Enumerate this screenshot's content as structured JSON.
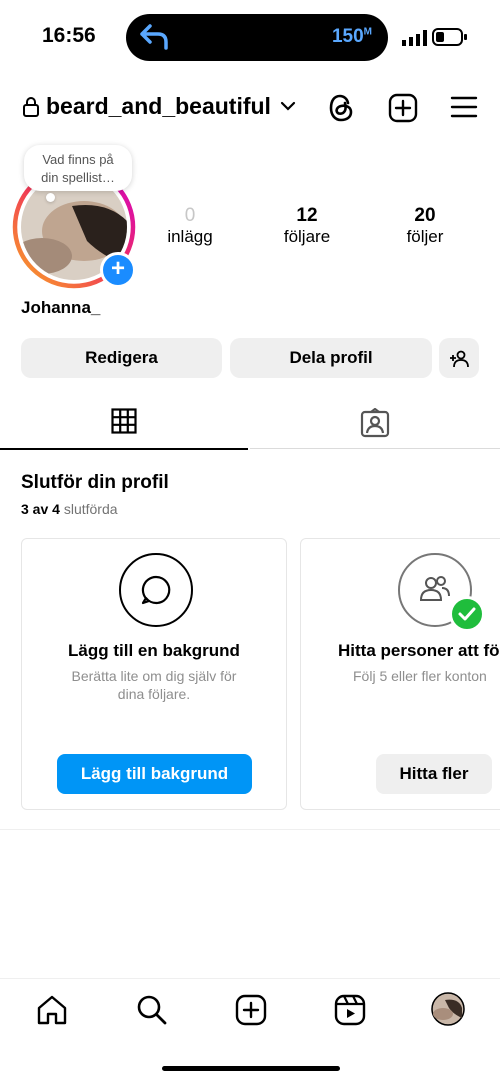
{
  "status_bar": {
    "time": "16:56",
    "timer": "150",
    "timer_unit": "M"
  },
  "header": {
    "username": "beard_and_beautiful"
  },
  "note": {
    "text_line1": "Vad finns på",
    "text_line2": "din spellist…"
  },
  "stats": [
    {
      "value": "0",
      "label": "inlägg"
    },
    {
      "value": "12",
      "label": "följare"
    },
    {
      "value": "20",
      "label": "följer"
    }
  ],
  "profile": {
    "display_name": "Johanna_"
  },
  "buttons": {
    "edit": "Redigera",
    "share": "Dela profil"
  },
  "complete_profile": {
    "title": "Slutför din profil",
    "progress_bold": "3 av 4",
    "progress_rest": "slutförda",
    "cards": [
      {
        "title": "Lägg till en bakgrund",
        "desc_line1": "Berätta lite om dig själv för",
        "desc_line2": "dina följare.",
        "button": "Lägg till bakgrund"
      },
      {
        "title": "Hitta personer att följa",
        "desc_line1": "Följ 5 eller fler konton",
        "button": "Hitta fler"
      }
    ]
  },
  "colors": {
    "accent": "#1a8cff",
    "ring_start": "#f9a825",
    "ring_end": "#d300c5",
    "success": "#1fbd3c"
  }
}
